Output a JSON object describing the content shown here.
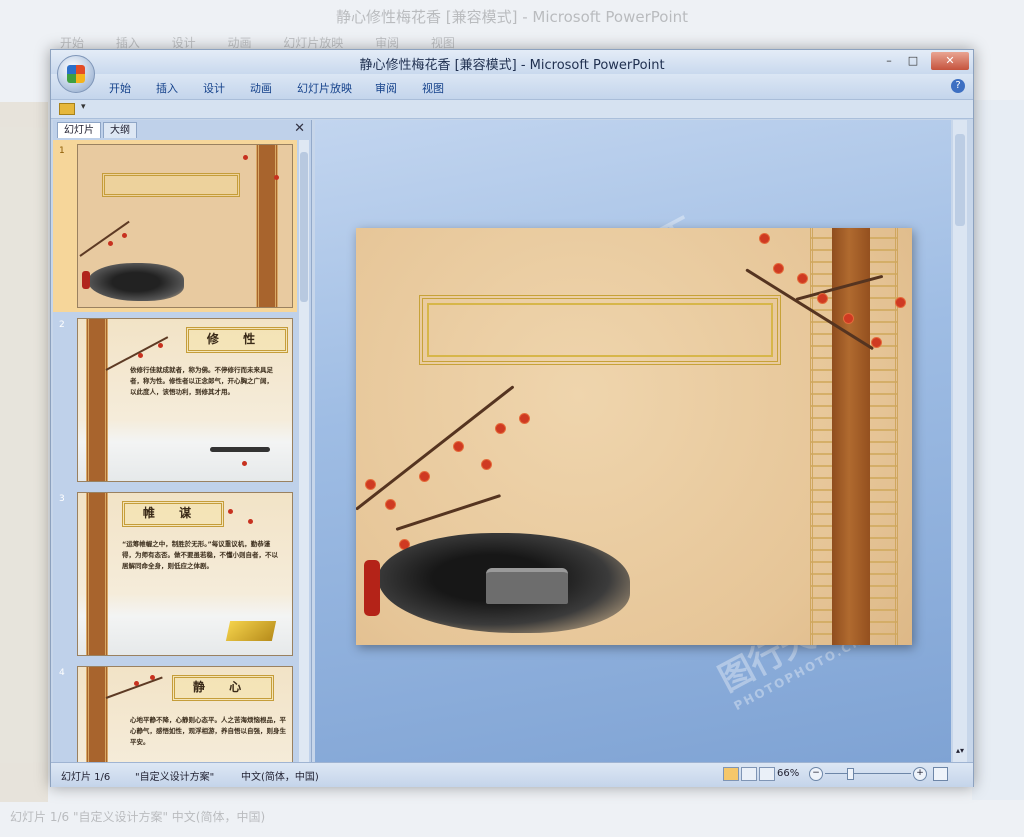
{
  "app": {
    "title": "静心修性梅花香 [兼容模式] - Microsoft PowerPoint"
  },
  "window_controls": {
    "minimize": "–",
    "maximize": "□",
    "close": "✕"
  },
  "menu": [
    "开始",
    "插入",
    "设计",
    "动画",
    "幻灯片放映",
    "审阅",
    "视图"
  ],
  "help_label": "?",
  "qat_arrow": "▾",
  "panel": {
    "tabs": [
      "幻灯片",
      "大纲"
    ],
    "close": "✕"
  },
  "slides": [
    {
      "num": "1"
    },
    {
      "num": "2",
      "title": "修 性",
      "body": "依修行佳就成就者，称为佛。不停修行而未来具足者，称为性。修性者以正念郎气，开心胸之广阔，以此度人，该悟功利，到修其才用。"
    },
    {
      "num": "3",
      "title": "帷 谋",
      "body": "“运筹帷幄之中，制胜於无形。”每议重议机，勤恭谨得，为师有态否。做不要虽若稳，不懂小则自者，不以居解同命全身，则低应之体剧。"
    },
    {
      "num": "4",
      "title": "静 心",
      "body": "心地平静不降，心静则心态平。人之苦海烦恼根品，平心静气，感悟如性，观浮相游，养自悟以自强，则身生平安。"
    }
  ],
  "watermark": {
    "cn": "图行天下",
    "en": "PHOTOPHOTO.CN"
  },
  "status": {
    "slide_pos": "幻灯片 1/6",
    "theme": "\"自定义设计方案\"",
    "lang": "中文(简体，中国)",
    "zoom": "66%",
    "zoom_minus": "−",
    "zoom_plus": "+"
  },
  "edit_scroll_arrows": "▴▾",
  "background": {
    "title": "静心修性梅花香 [兼容模式] - Microsoft PowerPoint",
    "menu": "开始 插入 设计 动画 幻灯片放映 审阅 视图",
    "status": "幻灯片 1/6   \"自定义设计方案\"   中文(简体，中国)"
  }
}
